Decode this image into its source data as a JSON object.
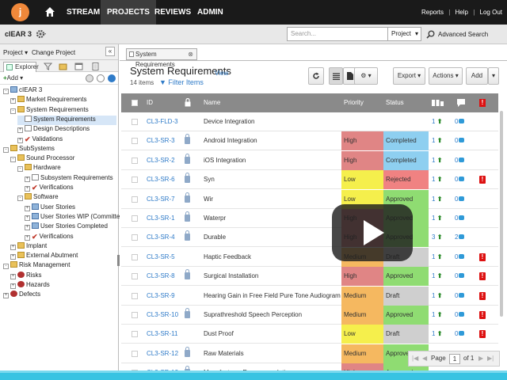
{
  "nav": {
    "logo": "j",
    "items": [
      "STREAM",
      "PROJECTS",
      "REVIEWS",
      "ADMIN"
    ],
    "right": [
      "Reports",
      "Help",
      "Log Out"
    ],
    "sep": "|"
  },
  "subbar": {
    "project": "cIEAR 3",
    "search_placeholder": "Search...",
    "search_scope": "Project",
    "advanced": "Advanced Search"
  },
  "left": {
    "project_menu": "Project ▾",
    "change_project": "Change Project",
    "collapse": "«",
    "explorer_tab": "Explorer",
    "add": "Add ▾",
    "tree": [
      {
        "label": "cIEAR 3",
        "icon": "cube",
        "pm": "-",
        "indent": 0
      },
      {
        "label": "Market Requirements",
        "icon": "folder",
        "pm": "+",
        "indent": 1
      },
      {
        "label": "System Requirements",
        "icon": "folder",
        "pm": "-",
        "indent": 1
      },
      {
        "label": "System Requirements",
        "icon": "doc",
        "pm": "",
        "indent": 2,
        "selected": true
      },
      {
        "label": "Design Descriptions",
        "icon": "doc",
        "pm": "+",
        "indent": 2
      },
      {
        "label": "Validations",
        "icon": "check",
        "pm": "+",
        "indent": 2
      },
      {
        "label": "SubSystems",
        "icon": "folder",
        "pm": "-",
        "indent": 0
      },
      {
        "label": "Sound Processor",
        "icon": "folder",
        "pm": "-",
        "indent": 1
      },
      {
        "label": "Hardware",
        "icon": "folder",
        "pm": "-",
        "indent": 2
      },
      {
        "label": "Subsystem Requirements",
        "icon": "doc",
        "pm": "+",
        "indent": 3
      },
      {
        "label": "Verifications",
        "icon": "check",
        "pm": "+",
        "indent": 3
      },
      {
        "label": "Software",
        "icon": "folder",
        "pm": "-",
        "indent": 2
      },
      {
        "label": "User Stories",
        "icon": "cube",
        "pm": "+",
        "indent": 3
      },
      {
        "label": "User Stories WIP (Committed)",
        "icon": "cube",
        "pm": "+",
        "indent": 3
      },
      {
        "label": "User Stories Completed",
        "icon": "cube",
        "pm": "+",
        "indent": 3
      },
      {
        "label": "Verifications",
        "icon": "check",
        "pm": "+",
        "indent": 3
      },
      {
        "label": "Implant",
        "icon": "folder",
        "pm": "+",
        "indent": 1
      },
      {
        "label": "External Abutment",
        "icon": "folder",
        "pm": "+",
        "indent": 1
      },
      {
        "label": "Risk Management",
        "icon": "folder",
        "pm": "-",
        "indent": 0
      },
      {
        "label": "Risks",
        "icon": "bug",
        "pm": "+",
        "indent": 1
      },
      {
        "label": "Hazards",
        "icon": "bug",
        "pm": "+",
        "indent": 1
      },
      {
        "label": "Defects",
        "icon": "bug",
        "pm": "+",
        "indent": 0
      }
    ]
  },
  "main": {
    "tab_label": "System Requirements",
    "tab_close": "⊗",
    "title": "System Requirements",
    "view_link": "View",
    "item_count": "14 items",
    "filter": "Filter Items",
    "buttons": {
      "export": "Export ▾",
      "actions": "Actions ▾",
      "add": "Add",
      "gear": "⚙ ▾"
    },
    "columns": {
      "id": "ID",
      "name": "Name",
      "priority": "Priority",
      "status": "Status"
    },
    "rows": [
      {
        "id": "CL3-FLD-3",
        "lock": false,
        "name": "Device Integration",
        "priority": "",
        "status": "",
        "links": "1",
        "comments": "0",
        "warn": false
      },
      {
        "id": "CL3-SR-3",
        "lock": true,
        "name": "Android Integration",
        "priority": "High",
        "status": "Completed",
        "links": "1",
        "comments": "0",
        "warn": false
      },
      {
        "id": "CL3-SR-2",
        "lock": true,
        "name": "iOS Integration",
        "priority": "High",
        "status": "Completed",
        "links": "1",
        "comments": "0",
        "warn": false
      },
      {
        "id": "CL3-SR-6",
        "lock": true,
        "name": "Syn",
        "priority": "Low",
        "status": "Rejected",
        "links": "1",
        "comments": "0",
        "warn": true
      },
      {
        "id": "CL3-SR-7",
        "lock": true,
        "name": "Wir",
        "priority": "Low",
        "status": "Approved",
        "links": "1",
        "comments": "0",
        "warn": false
      },
      {
        "id": "CL3-SR-1",
        "lock": true,
        "name": "Waterpr",
        "priority": "High",
        "status": "Approved",
        "links": "1",
        "comments": "0",
        "warn": false
      },
      {
        "id": "CL3-SR-4",
        "lock": true,
        "name": "Durable",
        "priority": "High",
        "status": "Approved",
        "links": "3",
        "comments": "2",
        "warn": false
      },
      {
        "id": "CL3-SR-5",
        "lock": false,
        "name": "Haptic Feedback",
        "priority": "Medium",
        "status": "Draft",
        "links": "1",
        "comments": "0",
        "warn": true
      },
      {
        "id": "CL3-SR-8",
        "lock": true,
        "name": "Surgical Installation",
        "priority": "High",
        "status": "Approved",
        "links": "1",
        "comments": "0",
        "warn": true
      },
      {
        "id": "CL3-SR-9",
        "lock": false,
        "name": "Hearing Gain in Free Field Pure Tone Audiogram",
        "priority": "Medium",
        "status": "Draft",
        "links": "1",
        "comments": "0",
        "warn": true
      },
      {
        "id": "CL3-SR-10",
        "lock": true,
        "name": "Suprathreshold Speech Perception",
        "priority": "Medium",
        "status": "Approved",
        "links": "1",
        "comments": "0",
        "warn": true
      },
      {
        "id": "CL3-SR-11",
        "lock": false,
        "name": "Dust Proof",
        "priority": "Low",
        "status": "Draft",
        "links": "1",
        "comments": "0",
        "warn": true
      },
      {
        "id": "CL3-SR-12",
        "lock": true,
        "name": "Raw Materials",
        "priority": "Medium",
        "status": "Approved",
        "links": "",
        "comments": "",
        "warn": false
      },
      {
        "id": "CL3-SR-13",
        "lock": true,
        "name": "Manufacturer Recommendations",
        "priority": "High",
        "status": "Approved",
        "links": "",
        "comments": "",
        "warn": false
      }
    ],
    "pager": {
      "page_label": "Page",
      "page": "1",
      "of": "of 1"
    }
  },
  "colors": {
    "High": "#e08585",
    "Medium": "#f5b860",
    "Low": "#f5ef4c",
    "Completed": "#8ecff0",
    "Rejected": "#f08282",
    "Approved": "#8fdc72",
    "Draft": "#cfcfcf"
  }
}
